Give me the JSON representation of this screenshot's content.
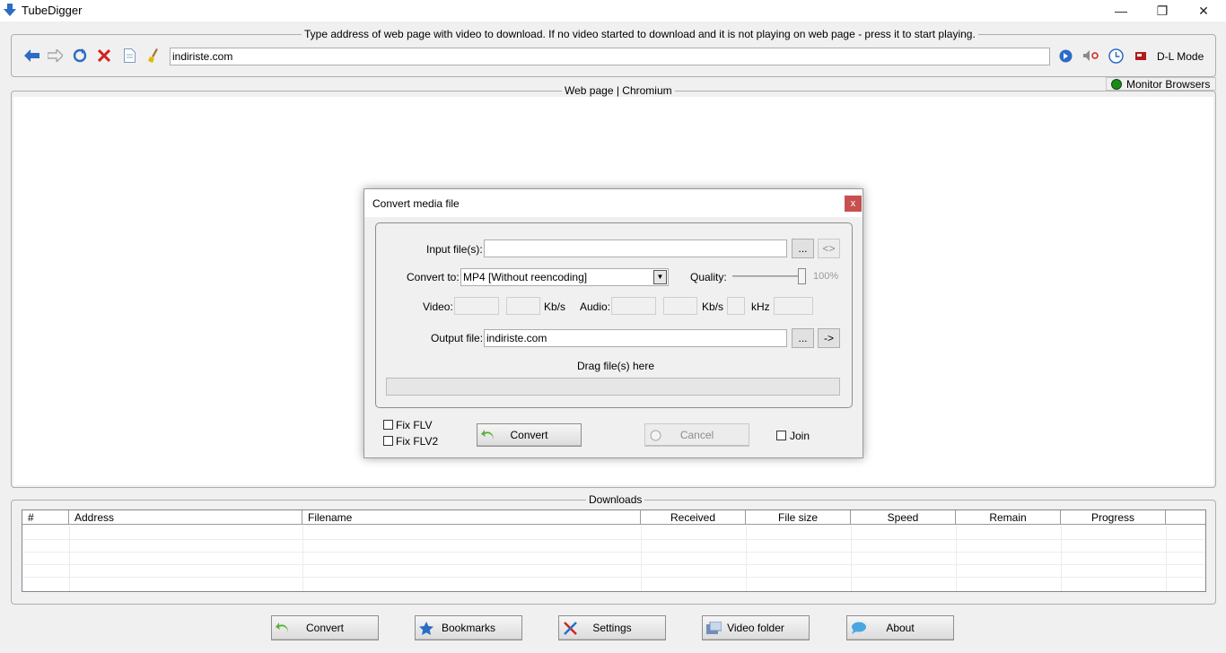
{
  "app": {
    "title": "TubeDigger"
  },
  "window_controls": {
    "minimize": "—",
    "restore": "❐",
    "close": "✕"
  },
  "address_group": {
    "title": "Type address of web page with video to download. If no video started to download and it is not playing on web page - press it to start playing.",
    "url": "indiriste.com",
    "dl_mode": "D-L Mode",
    "toolbar_icons": [
      "back-icon",
      "forward-icon",
      "refresh-icon",
      "stop-icon",
      "page-icon",
      "clear-icon"
    ],
    "right_icons": [
      "go-icon",
      "mute-icon",
      "clock-icon",
      "record-icon"
    ]
  },
  "browser": {
    "title": "Web page | Chromium",
    "monitor_label": "Monitor Browsers",
    "monitor_color": "#1a8a1a"
  },
  "dialog": {
    "title": "Convert media file",
    "close": "x",
    "input_label": "Input file(s):",
    "input_value": "",
    "browse": "...",
    "swap_in": "<>",
    "convert_to_label": "Convert to:",
    "convert_to_value": "MP4 [Without reencoding]",
    "quality_label": "Quality:",
    "quality_value": "100%",
    "quality_level": 1.0,
    "video_label": "Video:",
    "kbs1": "Kb/s",
    "audio_label": "Audio:",
    "kbs2": "Kb/s",
    "khz": "kHz",
    "output_label": "Output file:",
    "output_value": "indiriste.com",
    "browse_out": "...",
    "go_out": "->",
    "drag_hint": "Drag file(s) here",
    "fix_flv": "Fix FLV",
    "fix_flv2": "Fix FLV2",
    "convert_btn": "Convert",
    "cancel_btn": "Cancel",
    "join": "Join"
  },
  "downloads": {
    "title": "Downloads",
    "columns": [
      "#",
      "Address",
      "Filename",
      "Received",
      "File size",
      "Speed",
      "Remain",
      "Progress"
    ]
  },
  "bottom_buttons": [
    {
      "label": "Convert",
      "icon": "convert-icon"
    },
    {
      "label": "Bookmarks",
      "icon": "star-icon"
    },
    {
      "label": "Settings",
      "icon": "tools-icon"
    },
    {
      "label": "Video folder",
      "icon": "folder-icon"
    },
    {
      "label": "About",
      "icon": "chat-icon"
    }
  ],
  "colors": {
    "accent_blue": "#2b6cc4",
    "close_red": "#c75050",
    "stop_red": "#d42020"
  }
}
